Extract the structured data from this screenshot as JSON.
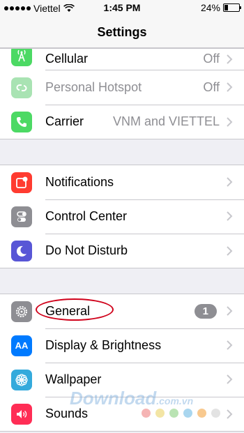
{
  "status_bar": {
    "carrier": "Viettel",
    "time": "1:45 PM",
    "battery": "24%",
    "battery_level": 0.24
  },
  "nav": {
    "title": "Settings"
  },
  "groups": [
    {
      "rows": [
        {
          "label": "Cellular",
          "value": "Off",
          "icon": "antenna-icon",
          "color": "#4cd964",
          "dim": false
        },
        {
          "label": "Personal Hotspot",
          "value": "Off",
          "icon": "hotspot-chain-icon",
          "color": "#a9e3b3",
          "dim": true
        },
        {
          "label": "Carrier",
          "value": "VNM and VIETTEL",
          "icon": "phone-icon",
          "color": "#4cd964",
          "dim": false
        }
      ]
    },
    {
      "rows": [
        {
          "label": "Notifications",
          "icon": "notifications-icon",
          "color": "#ff3b30"
        },
        {
          "label": "Control Center",
          "icon": "toggle-switches-icon",
          "color": "#8e8e93"
        },
        {
          "label": "Do Not Disturb",
          "icon": "moon-icon",
          "color": "#5856d6"
        }
      ]
    },
    {
      "rows": [
        {
          "label": "General",
          "badge": "1",
          "icon": "gear-icon",
          "color": "#8e8e93"
        },
        {
          "label": "Display & Brightness",
          "icon": "text-size-icon",
          "color": "#007aff",
          "icon_text": "AA"
        },
        {
          "label": "Wallpaper",
          "icon": "flower-icon",
          "color": "#34aadc"
        },
        {
          "label": "Sounds",
          "icon": "speaker-icon",
          "color": "#ff2d55"
        }
      ]
    }
  ],
  "watermark": {
    "text": "Download",
    "suffix": ".com.vn",
    "dot_colors": [
      "#f5b4b4",
      "#f3e5a5",
      "#b9e3b3",
      "#a9d6ef",
      "#f8c98f",
      "#e3e3e3"
    ]
  }
}
